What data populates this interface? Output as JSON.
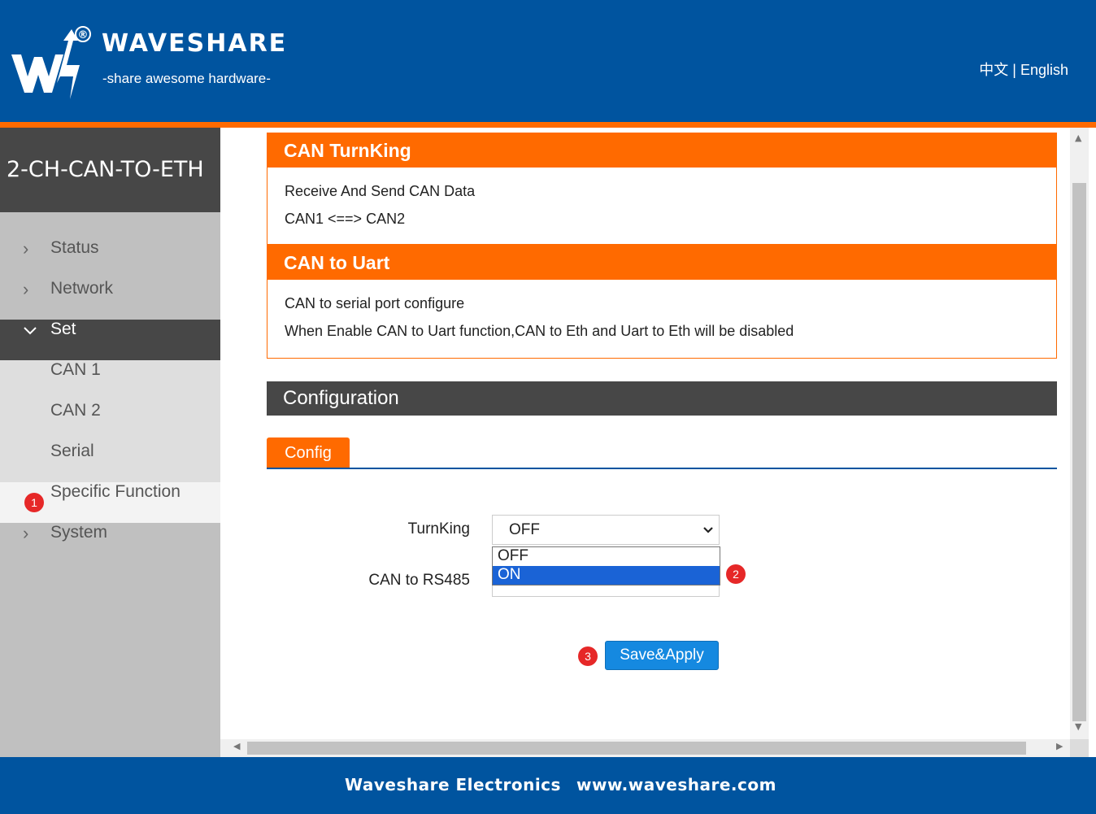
{
  "header": {
    "brand": "WAVESHARE",
    "tagline": "-share awesome hardware-",
    "registered": "®",
    "lang_cn": "中文",
    "lang_sep": "|",
    "lang_en": "English"
  },
  "sidebar": {
    "device_title": "2-CH-CAN-TO-ETH",
    "items": [
      {
        "label": "Status",
        "icon": "chevron-right-icon"
      },
      {
        "label": "Network",
        "icon": "chevron-right-icon"
      },
      {
        "label": "Set",
        "icon": "chevron-down-icon"
      },
      {
        "label": "CAN 1"
      },
      {
        "label": "CAN 2"
      },
      {
        "label": "Serial"
      },
      {
        "label": "Specific Function"
      },
      {
        "label": "System",
        "icon": "chevron-right-icon"
      }
    ]
  },
  "panels": {
    "turnking": {
      "title": "CAN TurnKing",
      "lines": [
        "Receive And Send CAN Data",
        "CAN1 <==> CAN2"
      ]
    },
    "can_uart": {
      "title": "CAN to Uart",
      "lines": [
        "CAN to serial port configure",
        "When Enable CAN to Uart function,CAN to Eth and Uart to Eth will be disabled"
      ]
    }
  },
  "config": {
    "section_title": "Configuration",
    "tab_label": "Config",
    "turnking_label": "TurnKing",
    "turnking_value": "OFF",
    "can485_label": "CAN to RS485",
    "dropdown_options": [
      "OFF",
      "ON"
    ],
    "selected_option": "ON",
    "save_button": "Save&Apply"
  },
  "annotations": [
    "1",
    "2",
    "3"
  ],
  "footer": {
    "company": "Waveshare Electronics",
    "url": "www.waveshare.com"
  },
  "colors": {
    "header_blue": "#00549f",
    "accent_orange": "#ff6a00",
    "dark_gray": "#474747",
    "button_blue": "#1589e0",
    "badge_red": "#e62828"
  }
}
